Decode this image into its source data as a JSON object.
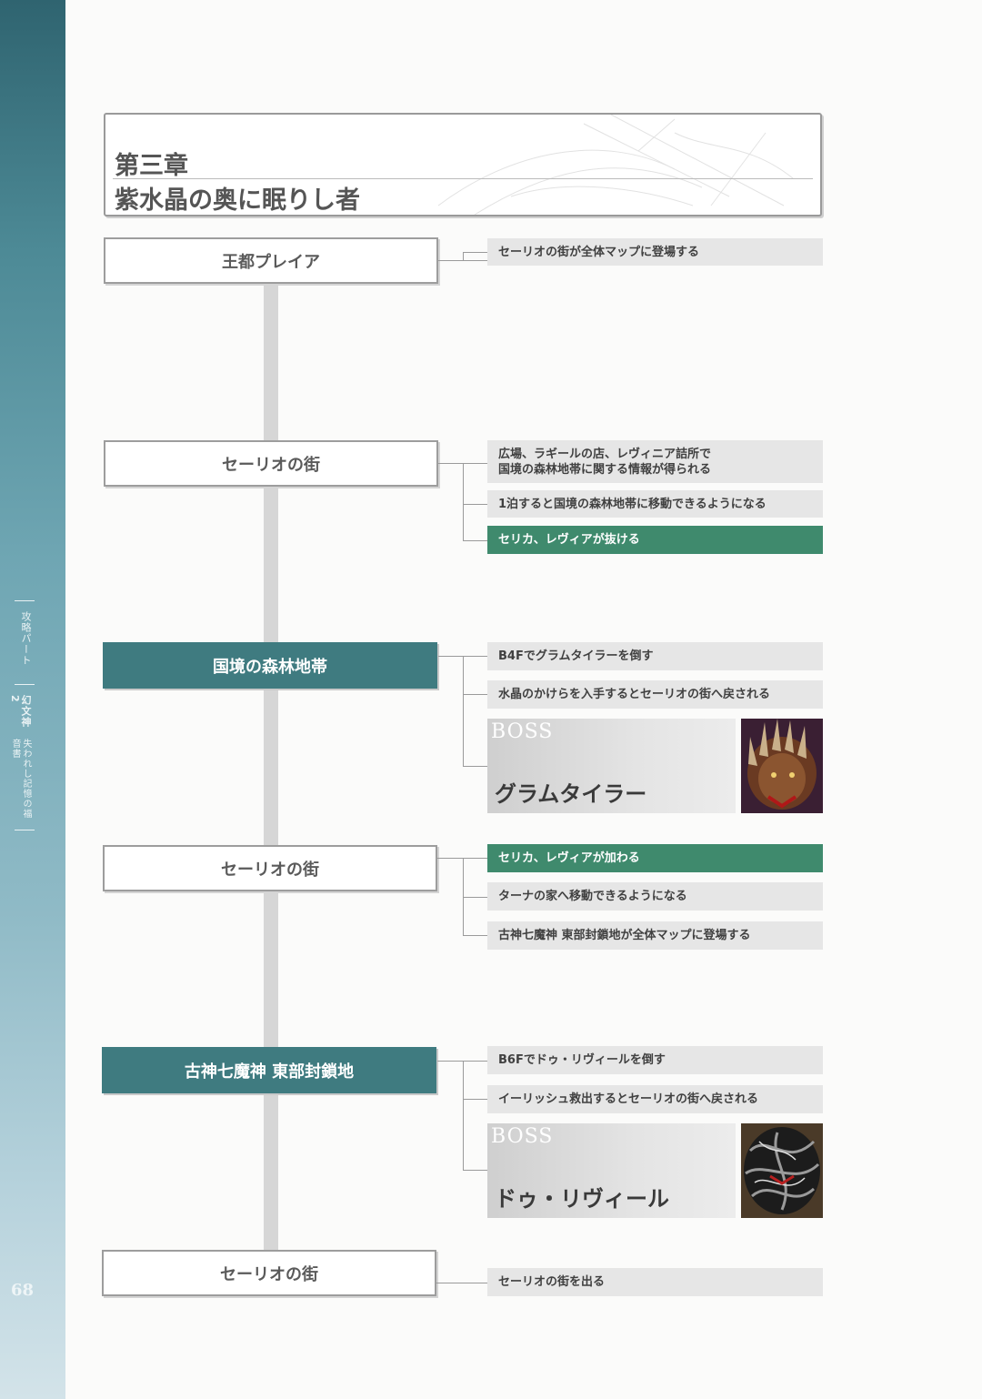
{
  "sidebar": {
    "section": "攻略パート",
    "game": "幻文神2",
    "subtitle": "失われし記憶の福音書",
    "page_number": "68"
  },
  "chapter": {
    "number": "第三章",
    "title": "紫水晶の奥に眠りし者"
  },
  "flow": [
    {
      "location": "王都プレイア",
      "kind": "town",
      "events": [
        "セーリオの街が全体マップに登場する"
      ]
    },
    {
      "location": "セーリオの街",
      "kind": "town",
      "events": [
        "広場、ラギールの店、レヴィニア詰所で\n国境の森林地帯に関する情報が得られる",
        "1泊すると国境の森林地帯に移動できるようになる",
        "セリカ、レヴィアが抜ける"
      ]
    },
    {
      "location": "国境の森林地帯",
      "kind": "dungeon",
      "events": [
        "B4Fでグラムタイラーを倒す",
        "水晶のかけらを入手するとセーリオの街へ戻される"
      ],
      "boss": {
        "label": "BOSS",
        "name": "グラムタイラー"
      }
    },
    {
      "location": "セーリオの街",
      "kind": "town",
      "events": [
        "セリカ、レヴィアが加わる",
        "ターナの家へ移動できるようになる",
        "古神七魔神 東部封鎖地が全体マップに登場する"
      ]
    },
    {
      "location": "古神七魔神 東部封鎖地",
      "kind": "dungeon",
      "events": [
        "B6Fでドゥ・リヴィールを倒す",
        "イーリッシュ救出するとセーリオの街へ戻される"
      ],
      "boss": {
        "label": "BOSS",
        "name": "ドゥ・リヴィール"
      }
    },
    {
      "location": "セーリオの街",
      "kind": "town",
      "events": [
        "セーリオの街を出る"
      ]
    }
  ],
  "colors": {
    "sidebar": "#4d8a96",
    "dungeon_box": "#3f7b80",
    "highlight_event": "#3f8a6d",
    "event_box": "#e6e6e6"
  },
  "icons": [
    "boss-portrait-gram-tyrant",
    "boss-portrait-du-rivir"
  ]
}
